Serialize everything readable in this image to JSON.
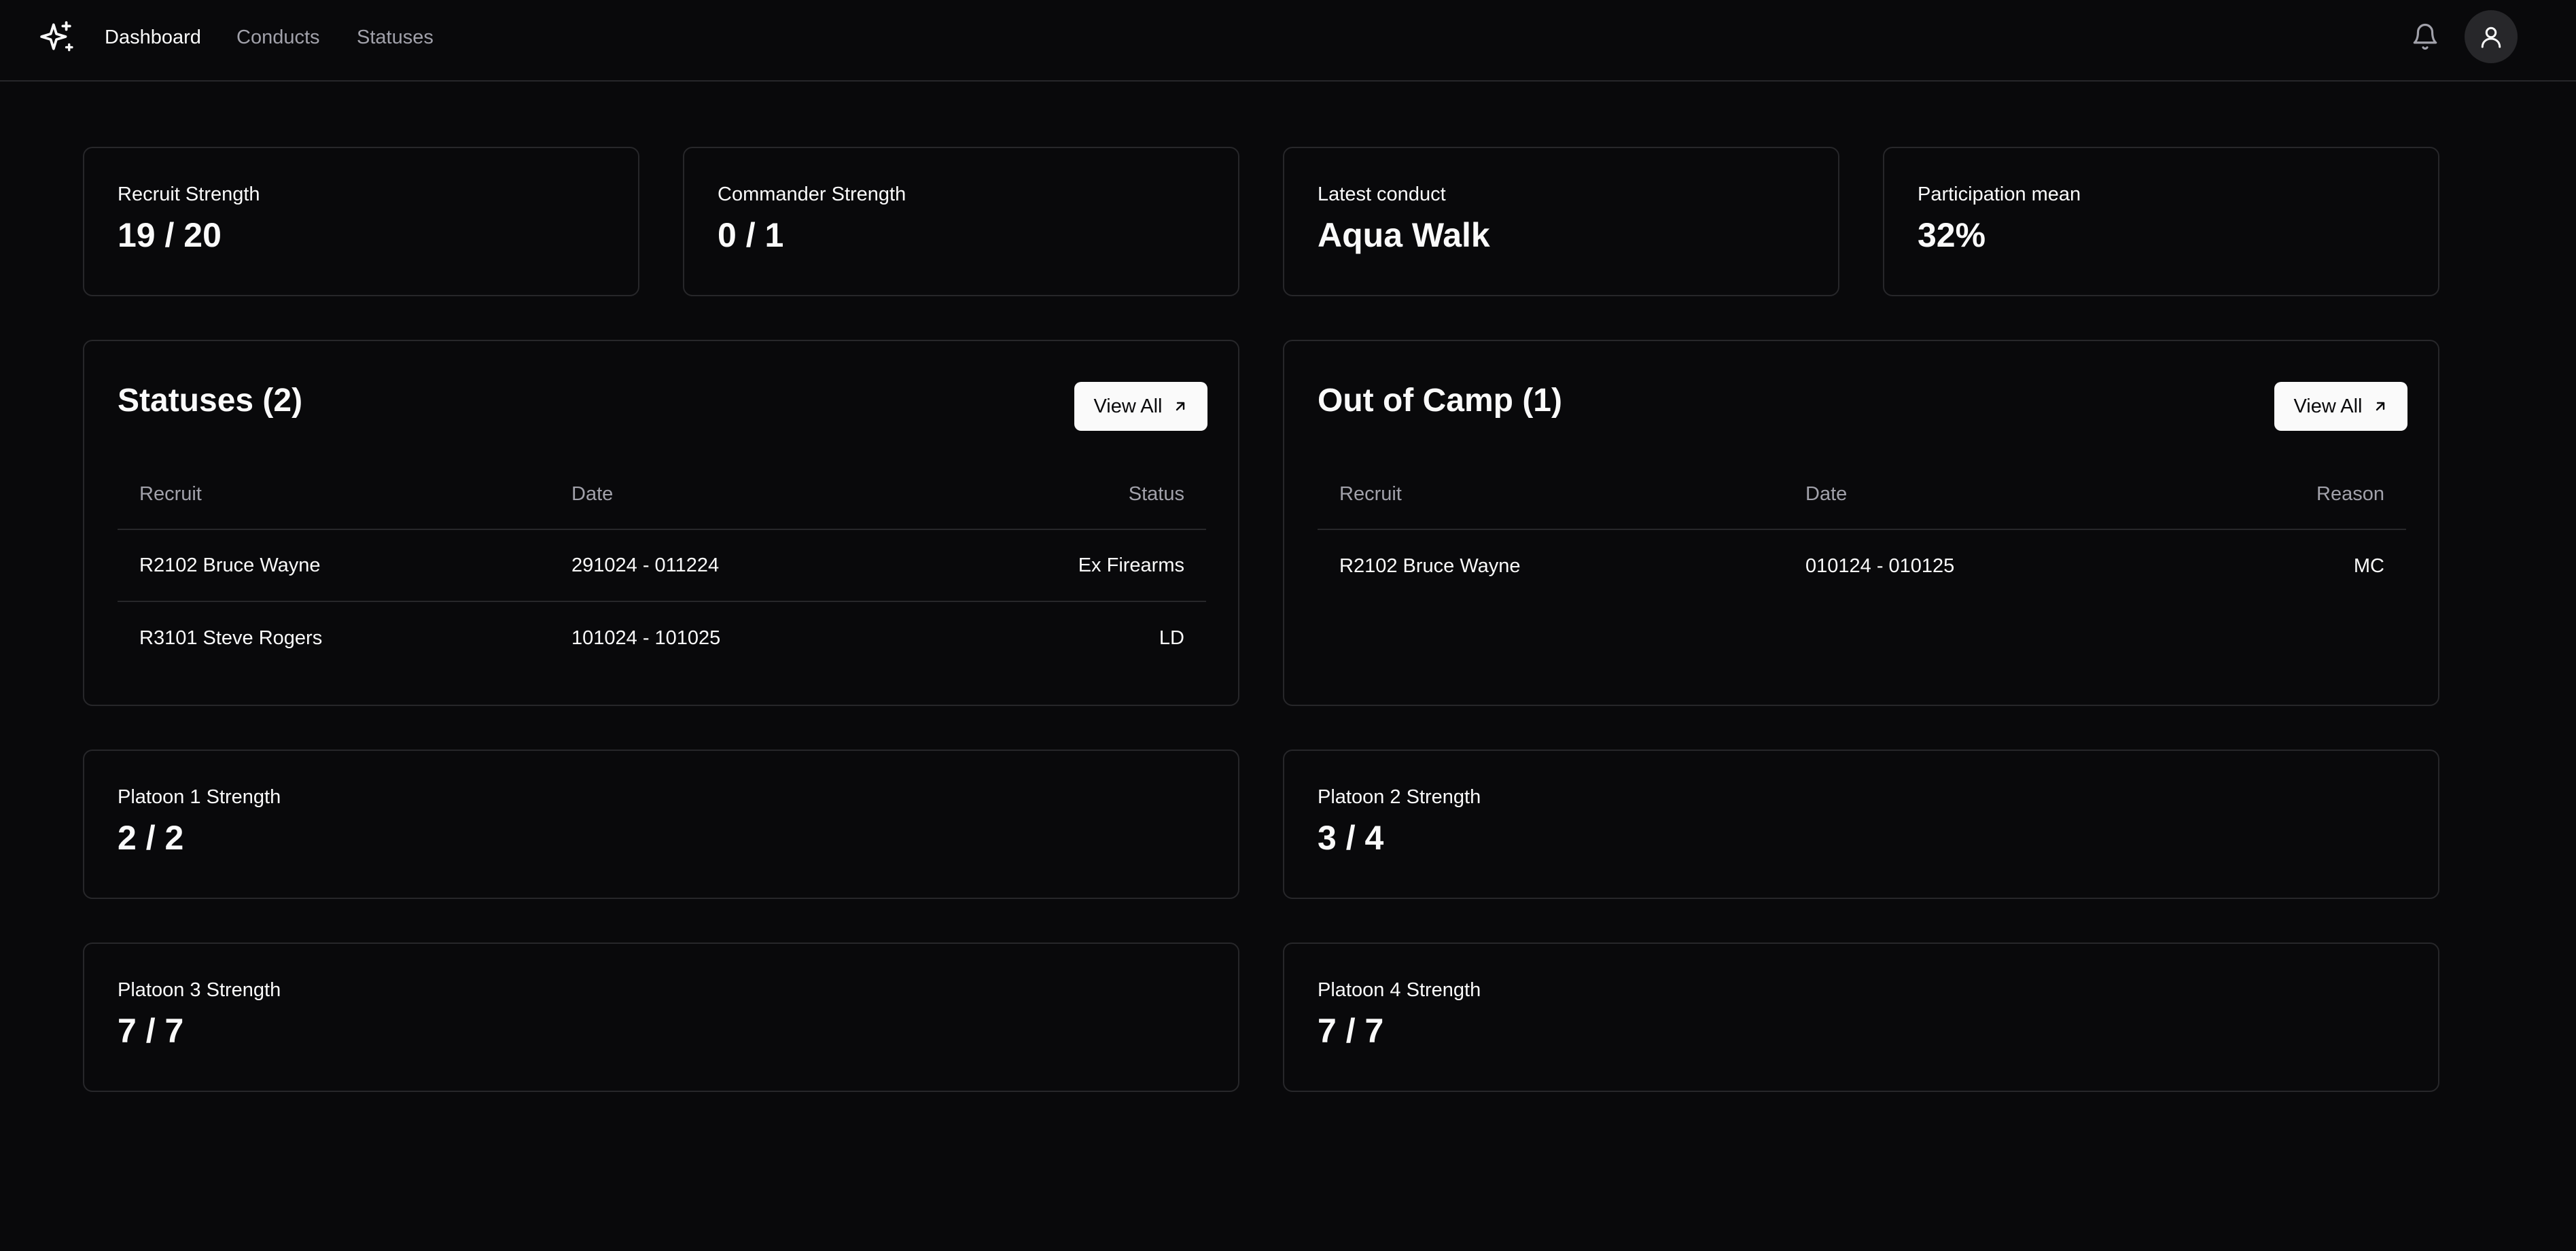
{
  "nav": {
    "links": [
      "Dashboard",
      "Conducts",
      "Statuses"
    ],
    "active": "Dashboard"
  },
  "stats": [
    {
      "label": "Recruit Strength",
      "value": "19 / 20"
    },
    {
      "label": "Commander Strength",
      "value": "0 / 1"
    },
    {
      "label": "Latest conduct",
      "value": "Aqua Walk"
    },
    {
      "label": "Participation mean",
      "value": "32%"
    }
  ],
  "statuses_panel": {
    "title": "Statuses (2)",
    "view_all_label": "View All",
    "columns": [
      "Recruit",
      "Date",
      "Status"
    ],
    "rows": [
      [
        "R2102 Bruce Wayne",
        "291024 - 011224",
        "Ex Firearms"
      ],
      [
        "R3101 Steve Rogers",
        "101024 - 101025",
        "LD"
      ]
    ]
  },
  "out_of_camp_panel": {
    "title": "Out of Camp (1)",
    "view_all_label": "View All",
    "columns": [
      "Recruit",
      "Date",
      "Reason"
    ],
    "rows": [
      [
        "R2102 Bruce Wayne",
        "010124 - 010125",
        "MC"
      ]
    ]
  },
  "platoons": [
    {
      "label": "Platoon 1 Strength",
      "value": "2 / 2"
    },
    {
      "label": "Platoon 2 Strength",
      "value": "3 / 4"
    },
    {
      "label": "Platoon 3 Strength",
      "value": "7 / 7"
    },
    {
      "label": "Platoon 4 Strength",
      "value": "7 / 7"
    }
  ],
  "icons": {
    "logo": "sparkles-icon",
    "notifications": "bell-icon",
    "account": "user-icon",
    "view_all": "arrow-up-right-icon"
  },
  "colors": {
    "background": "#09090b",
    "border": "#27272a",
    "text": "#fafafa",
    "muted": "#a1a1aa",
    "button_bg": "#fafafa",
    "button_text": "#09090b"
  }
}
